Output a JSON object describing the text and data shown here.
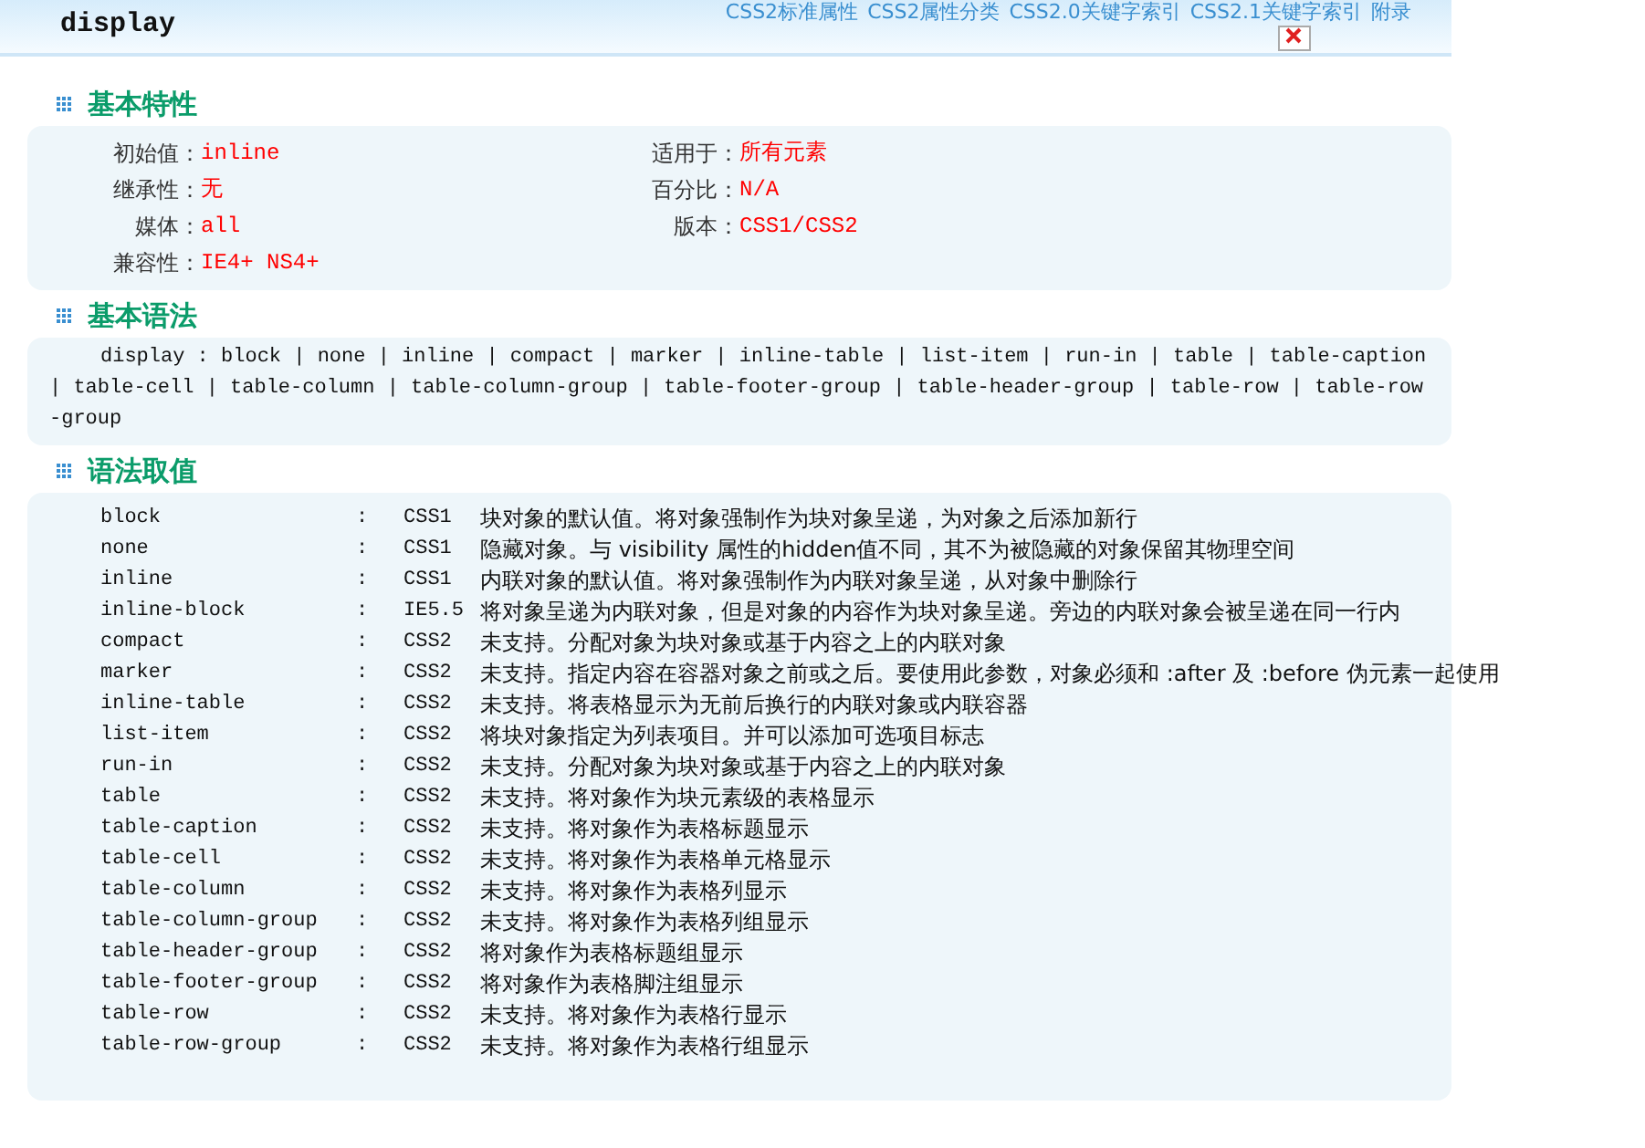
{
  "title": "display",
  "nav_links": [
    "CSS2标准属性",
    "CSS2属性分类",
    "CSS2.0关键字索引",
    "CSS2.1关键字索引",
    "附录"
  ],
  "sections": [
    {
      "kind": "props",
      "heading": "基本特性",
      "rows": [
        [
          {
            "label": "初始值：",
            "value": "inline"
          },
          {
            "label": "适用于：",
            "value": "所有元素"
          }
        ],
        [
          {
            "label": "继承性：",
            "value": "无"
          },
          {
            "label": "百分比：",
            "value": "N/A"
          }
        ],
        [
          {
            "label": "媒体：",
            "value": "all"
          },
          {
            "label": "版本：",
            "value": "CSS1/CSS2"
          }
        ],
        [
          {
            "label": "兼容性：",
            "value": "IE4+ NS4+"
          }
        ]
      ]
    },
    {
      "kind": "syntax",
      "heading": "基本语法",
      "text": "display : block | none | inline | compact | marker | inline-table | list-item | run-in | table | table-caption | table-cell | table-column | table-column-group | table-footer-group | table-header-group | table-row | table-row-group"
    },
    {
      "kind": "values",
      "heading": "语法取值",
      "rows": [
        {
          "name": "block",
          "sep": ":",
          "version": "CSS1",
          "desc": "块对象的默认值。将对象强制作为块对象呈递，为对象之后添加新行"
        },
        {
          "name": "none",
          "sep": ":",
          "version": "CSS1",
          "desc": "隐藏对象。与 visibility 属性的hidden值不同，其不为被隐藏的对象保留其物理空间"
        },
        {
          "name": "inline",
          "sep": ":",
          "version": "CSS1",
          "desc": "内联对象的默认值。将对象强制作为内联对象呈递，从对象中删除行"
        },
        {
          "name": "inline-block",
          "sep": ":",
          "version": "IE5.5",
          "desc": "将对象呈递为内联对象，但是对象的内容作为块对象呈递。旁边的内联对象会被呈递在同一行内"
        },
        {
          "name": "compact",
          "sep": ":",
          "version": "CSS2",
          "desc": "未支持。分配对象为块对象或基于内容之上的内联对象"
        },
        {
          "name": "marker",
          "sep": ":",
          "version": "CSS2",
          "desc": "未支持。指定内容在容器对象之前或之后。要使用此参数，对象必须和 :after 及 :before 伪元素一起使用"
        },
        {
          "name": "inline-table",
          "sep": ":",
          "version": "CSS2",
          "desc": "未支持。将表格显示为无前后换行的内联对象或内联容器"
        },
        {
          "name": "list-item",
          "sep": ":",
          "version": "CSS2",
          "desc": "将块对象指定为列表项目。并可以添加可选项目标志"
        },
        {
          "name": "run-in",
          "sep": ":",
          "version": "CSS2",
          "desc": "未支持。分配对象为块对象或基于内容之上的内联对象"
        },
        {
          "name": "table",
          "sep": ":",
          "version": "CSS2",
          "desc": "未支持。将对象作为块元素级的表格显示"
        },
        {
          "name": "table-caption",
          "sep": ":",
          "version": "CSS2",
          "desc": "未支持。将对象作为表格标题显示"
        },
        {
          "name": "table-cell",
          "sep": ":",
          "version": "CSS2",
          "desc": "未支持。将对象作为表格单元格显示"
        },
        {
          "name": "table-column",
          "sep": ":",
          "version": "CSS2",
          "desc": "未支持。将对象作为表格列显示"
        },
        {
          "name": "table-column-group",
          "sep": ":",
          "version": "CSS2",
          "desc": "未支持。将对象作为表格列组显示"
        },
        {
          "name": "table-header-group",
          "sep": ":",
          "version": "CSS2",
          "desc": "将对象作为表格标题组显示"
        },
        {
          "name": "table-footer-group",
          "sep": ":",
          "version": "CSS2",
          "desc": "将对象作为表格脚注组显示"
        },
        {
          "name": "table-row",
          "sep": ":",
          "version": "CSS2",
          "desc": "未支持。将对象作为表格行显示"
        },
        {
          "name": "table-row-group",
          "sep": ":",
          "version": "CSS2",
          "desc": "未支持。将对象作为表格行组显示"
        }
      ]
    }
  ]
}
